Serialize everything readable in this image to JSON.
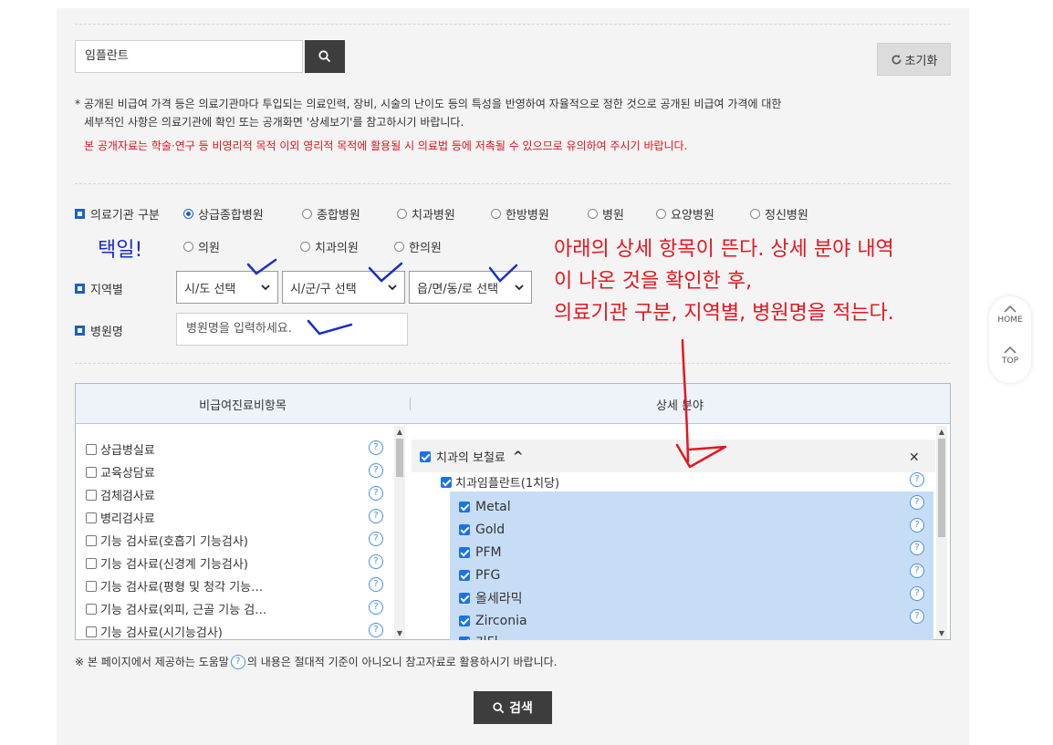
{
  "search": {
    "value": "임플란트"
  },
  "reset_label": "초기화",
  "notice": {
    "line1": "* 공개된 비급여 가격 등은 의료기관마다 투입되는 의료인력, 장비, 시술의 난이도 등의 특성을 반영하여 자율적으로 정한 것으로 공개된 비급여 가격에 대한",
    "line2": "세부적인 사항은 의료기관에 확인 또는 공개화면 '상세보기'를 참고하시기 바랍니다.",
    "warning": "본 공개자료는 학술·연구 등 비영리적 목적 이외 영리적 목적에 활용될 시 의료법 등에 저촉될 수 있으므로 유의하여 주시기 바랍니다."
  },
  "filters": {
    "institution_label": "의료기관 구분",
    "institution_options_row1": [
      "상급종합병원",
      "종합병원",
      "치과병원",
      "한방병원",
      "병원",
      "요양병원",
      "정신병원"
    ],
    "institution_options_row2": [
      "의원",
      "치과의원",
      "한의원"
    ],
    "selected_institution": "상급종합병원",
    "region_label": "지역별",
    "region_selects": [
      "시/도 선택",
      "시/군/구 선택",
      "읍/면/동/로 선택"
    ],
    "hospital_label": "병원명",
    "hospital_placeholder": "병원명을 입력하세요."
  },
  "box": {
    "left_header": "비급여진료비항목",
    "right_header": "상세 분야",
    "left_items": [
      "상급병실료",
      "교육상담료",
      "검체검사료",
      "병리검사료",
      "기능 검사료(호흡기 기능검사)",
      "기능 검사료(신경계 기능검사)",
      "기능 검사료(평형 및 청각 기능…",
      "기능 검사료(외피, 근골 기능 검…",
      "기능 검사료(시기능검사)"
    ],
    "category": "치과의 보철료",
    "category_toggle": "^",
    "close_symbol": "✕",
    "subcategory": "치과임플란트(1치당)",
    "detail_items": [
      "Metal",
      "Gold",
      "PFM",
      "PFG",
      "올세라믹",
      "Zirconia",
      "기타"
    ]
  },
  "help_symbol": "?",
  "footnote_before": "※ 본 페이지에서 제공하는 도움말",
  "footnote_after": "의 내용은 절대적 기준이 아니오니 참고자료로 활용하시기 바랍니다.",
  "submit_label": "검색",
  "side": {
    "home": "HOME",
    "top": "TOP"
  },
  "annotations": {
    "blue_choice": "택일!",
    "red_line1": "아래의 상세 항목이 뜬다. 상세 분야 내역",
    "red_line2": "이 나온 것을 확인한 후,",
    "red_line3": "의료기관 구분, 지역별, 병원명을 적는다."
  },
  "colors": {
    "accent": "#1a5fc9",
    "warning": "#e0141e",
    "annotation_red": "#e6161e",
    "annotation_blue": "#1a2ec9",
    "selected_bg": "#c7ddf6"
  }
}
